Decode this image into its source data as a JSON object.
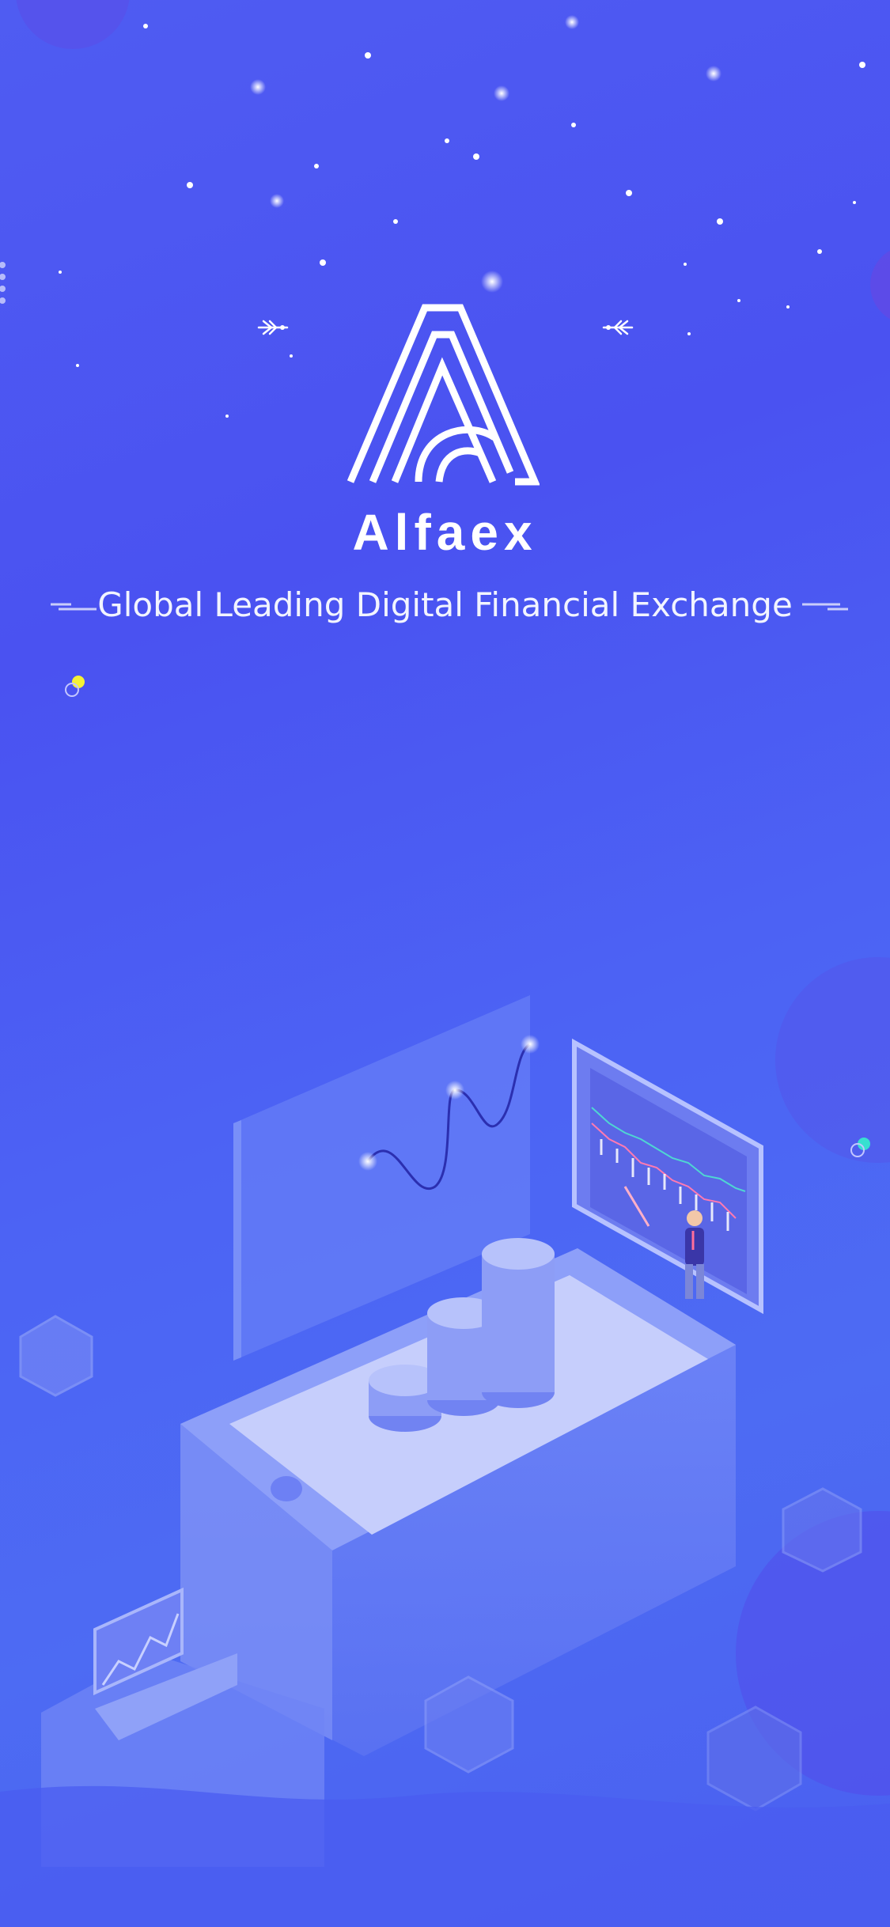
{
  "app": {
    "brand_name": "Alfaex",
    "tagline": "Global Leading Digital Financial Exchange"
  },
  "icons": {
    "logo": "alfaex-logo-letter-a-icon",
    "ornament_left": "wing-ornament-icon",
    "ornament_right": "wing-ornament-icon",
    "decorative_dashes": "dash-icon"
  },
  "colors": {
    "background_top": "#4f5cf2",
    "background_bottom": "#4a5ff0",
    "text": "#ffffff",
    "accent_yellow": "#f4f234",
    "accent_teal": "#37e0d0"
  }
}
